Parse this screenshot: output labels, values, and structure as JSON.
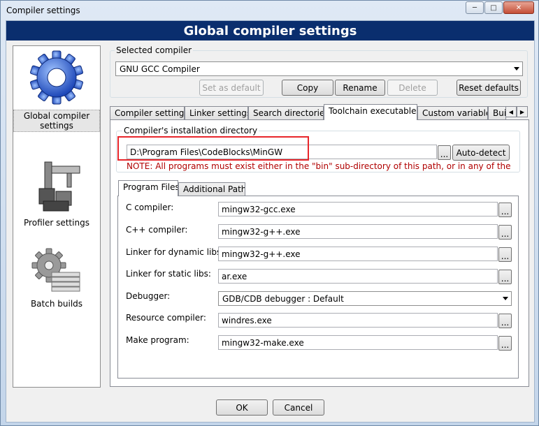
{
  "window": {
    "title": "Compiler settings",
    "minimize": "─",
    "maximize": "□",
    "close": "✕"
  },
  "banner": "Global compiler settings",
  "sidebar": {
    "items": [
      {
        "label": "Global compiler settings",
        "icon": "gear-icon"
      },
      {
        "label": "Profiler settings",
        "icon": "caliper-icon"
      },
      {
        "label": "Batch builds",
        "icon": "gear-stack-icon"
      }
    ]
  },
  "selected_compiler": {
    "label": "Selected compiler",
    "value": "GNU GCC Compiler",
    "buttons": {
      "set_default": "Set as default",
      "copy": "Copy",
      "rename": "Rename",
      "delete": "Delete",
      "reset": "Reset defaults"
    }
  },
  "tabs": [
    "Compiler settings",
    "Linker settings",
    "Search directories",
    "Toolchain executables",
    "Custom variables",
    "Bui"
  ],
  "active_tab": "Toolchain executables",
  "install_dir": {
    "label": "Compiler's installation directory",
    "value": "D:\\Program Files\\CodeBlocks\\MinGW",
    "browse": "...",
    "auto_detect": "Auto-detect",
    "note": "NOTE: All programs must exist either in the \"bin\" sub-directory of this path, or in any of the"
  },
  "subtabs": [
    "Program Files",
    "Additional Paths"
  ],
  "programs": [
    {
      "label": "C compiler:",
      "value": "mingw32-gcc.exe"
    },
    {
      "label": "C++ compiler:",
      "value": "mingw32-g++.exe"
    },
    {
      "label": "Linker for dynamic libs:",
      "value": "mingw32-g++.exe"
    },
    {
      "label": "Linker for static libs:",
      "value": "ar.exe"
    },
    {
      "label": "Debugger:",
      "value": "GDB/CDB debugger : Default"
    },
    {
      "label": "Resource compiler:",
      "value": "windres.exe"
    },
    {
      "label": "Make program:",
      "value": "mingw32-make.exe"
    }
  ],
  "browse_label": "...",
  "footer": {
    "ok": "OK",
    "cancel": "Cancel"
  },
  "colors": {
    "banner": "#0a2e6e",
    "highlight": "#e8262b",
    "note": "#b00000"
  }
}
